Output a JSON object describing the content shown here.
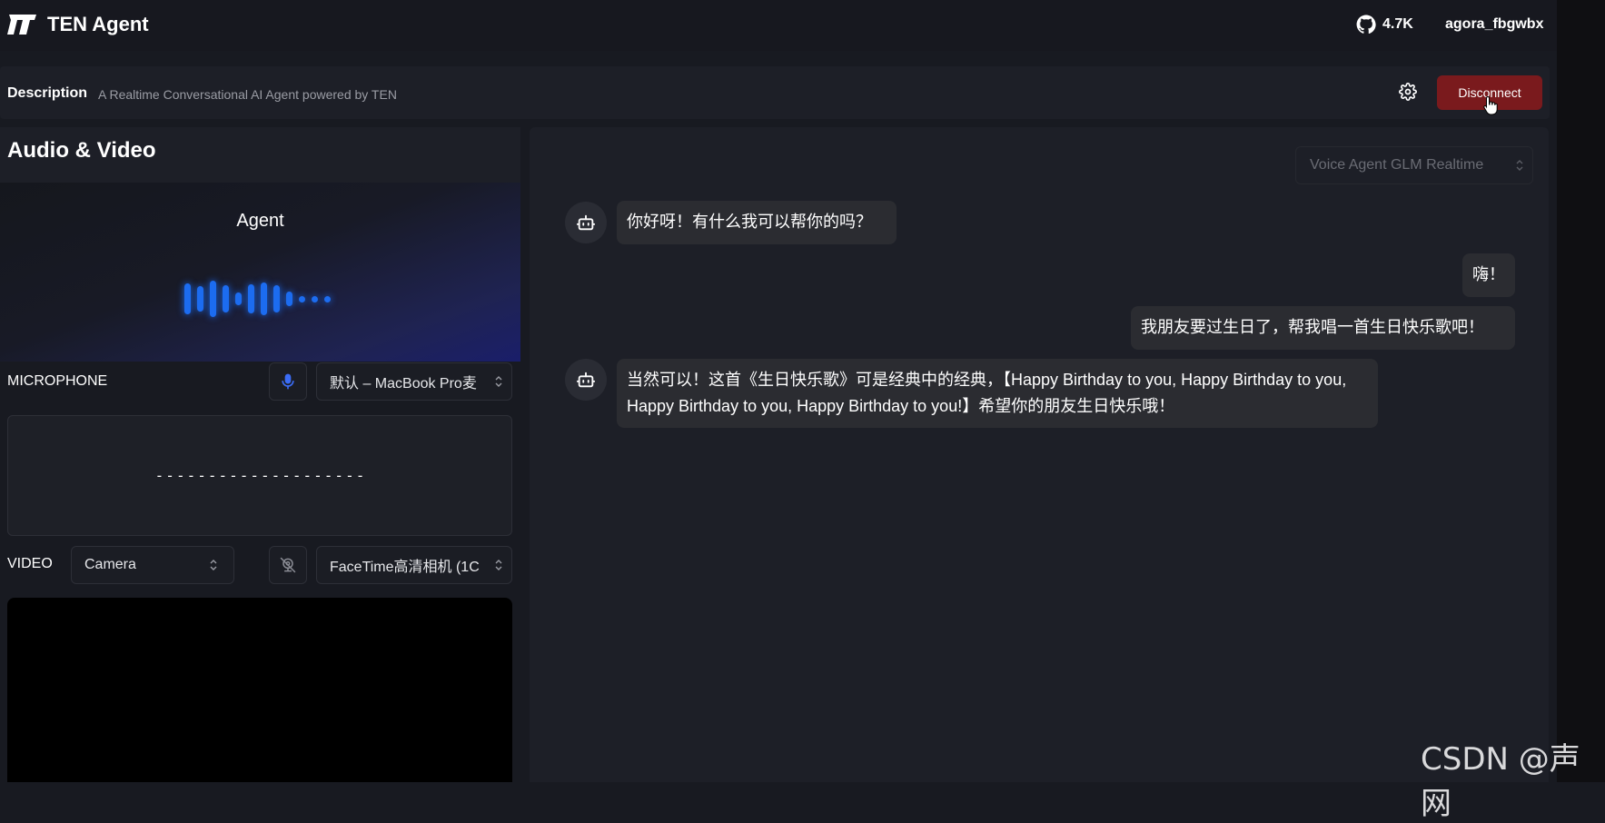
{
  "header": {
    "app_title": "TEN Agent",
    "github_stars": "4.7K",
    "username": "agora_fbgwbx"
  },
  "description_bar": {
    "label": "Description",
    "text": "A Realtime Conversational AI Agent powered by TEN",
    "disconnect_label": "Disconnect"
  },
  "left_panel": {
    "title": "Audio & Video",
    "agent_label": "Agent",
    "microphone": {
      "label": "MICROPHONE",
      "device": "默认 – MacBook Pro麦",
      "placeholder_line": "--------------------"
    },
    "video": {
      "label": "VIDEO",
      "source": "Camera",
      "device": "FaceTime高清相机 (1C"
    }
  },
  "chat": {
    "model_select": "Voice Agent GLM Realtime",
    "messages": [
      {
        "role": "agent",
        "text": "你好呀！有什么我可以帮你的吗？"
      },
      {
        "role": "user",
        "text": "嗨！"
      },
      {
        "role": "user",
        "text": "我朋友要过生日了，帮我唱一首生日快乐歌吧！"
      },
      {
        "role": "agent",
        "text": "当然可以！这首《生日快乐歌》可是经典中的经典，【Happy Birthday to you, Happy Birthday to you, Happy Birthday to you, Happy Birthday to you!】希望你的朋友生日快乐哦！"
      }
    ]
  },
  "watermark": "CSDN @声网",
  "colors": {
    "accent_blue": "#1c6cf0",
    "disconnect_red": "#7a1a1d"
  }
}
